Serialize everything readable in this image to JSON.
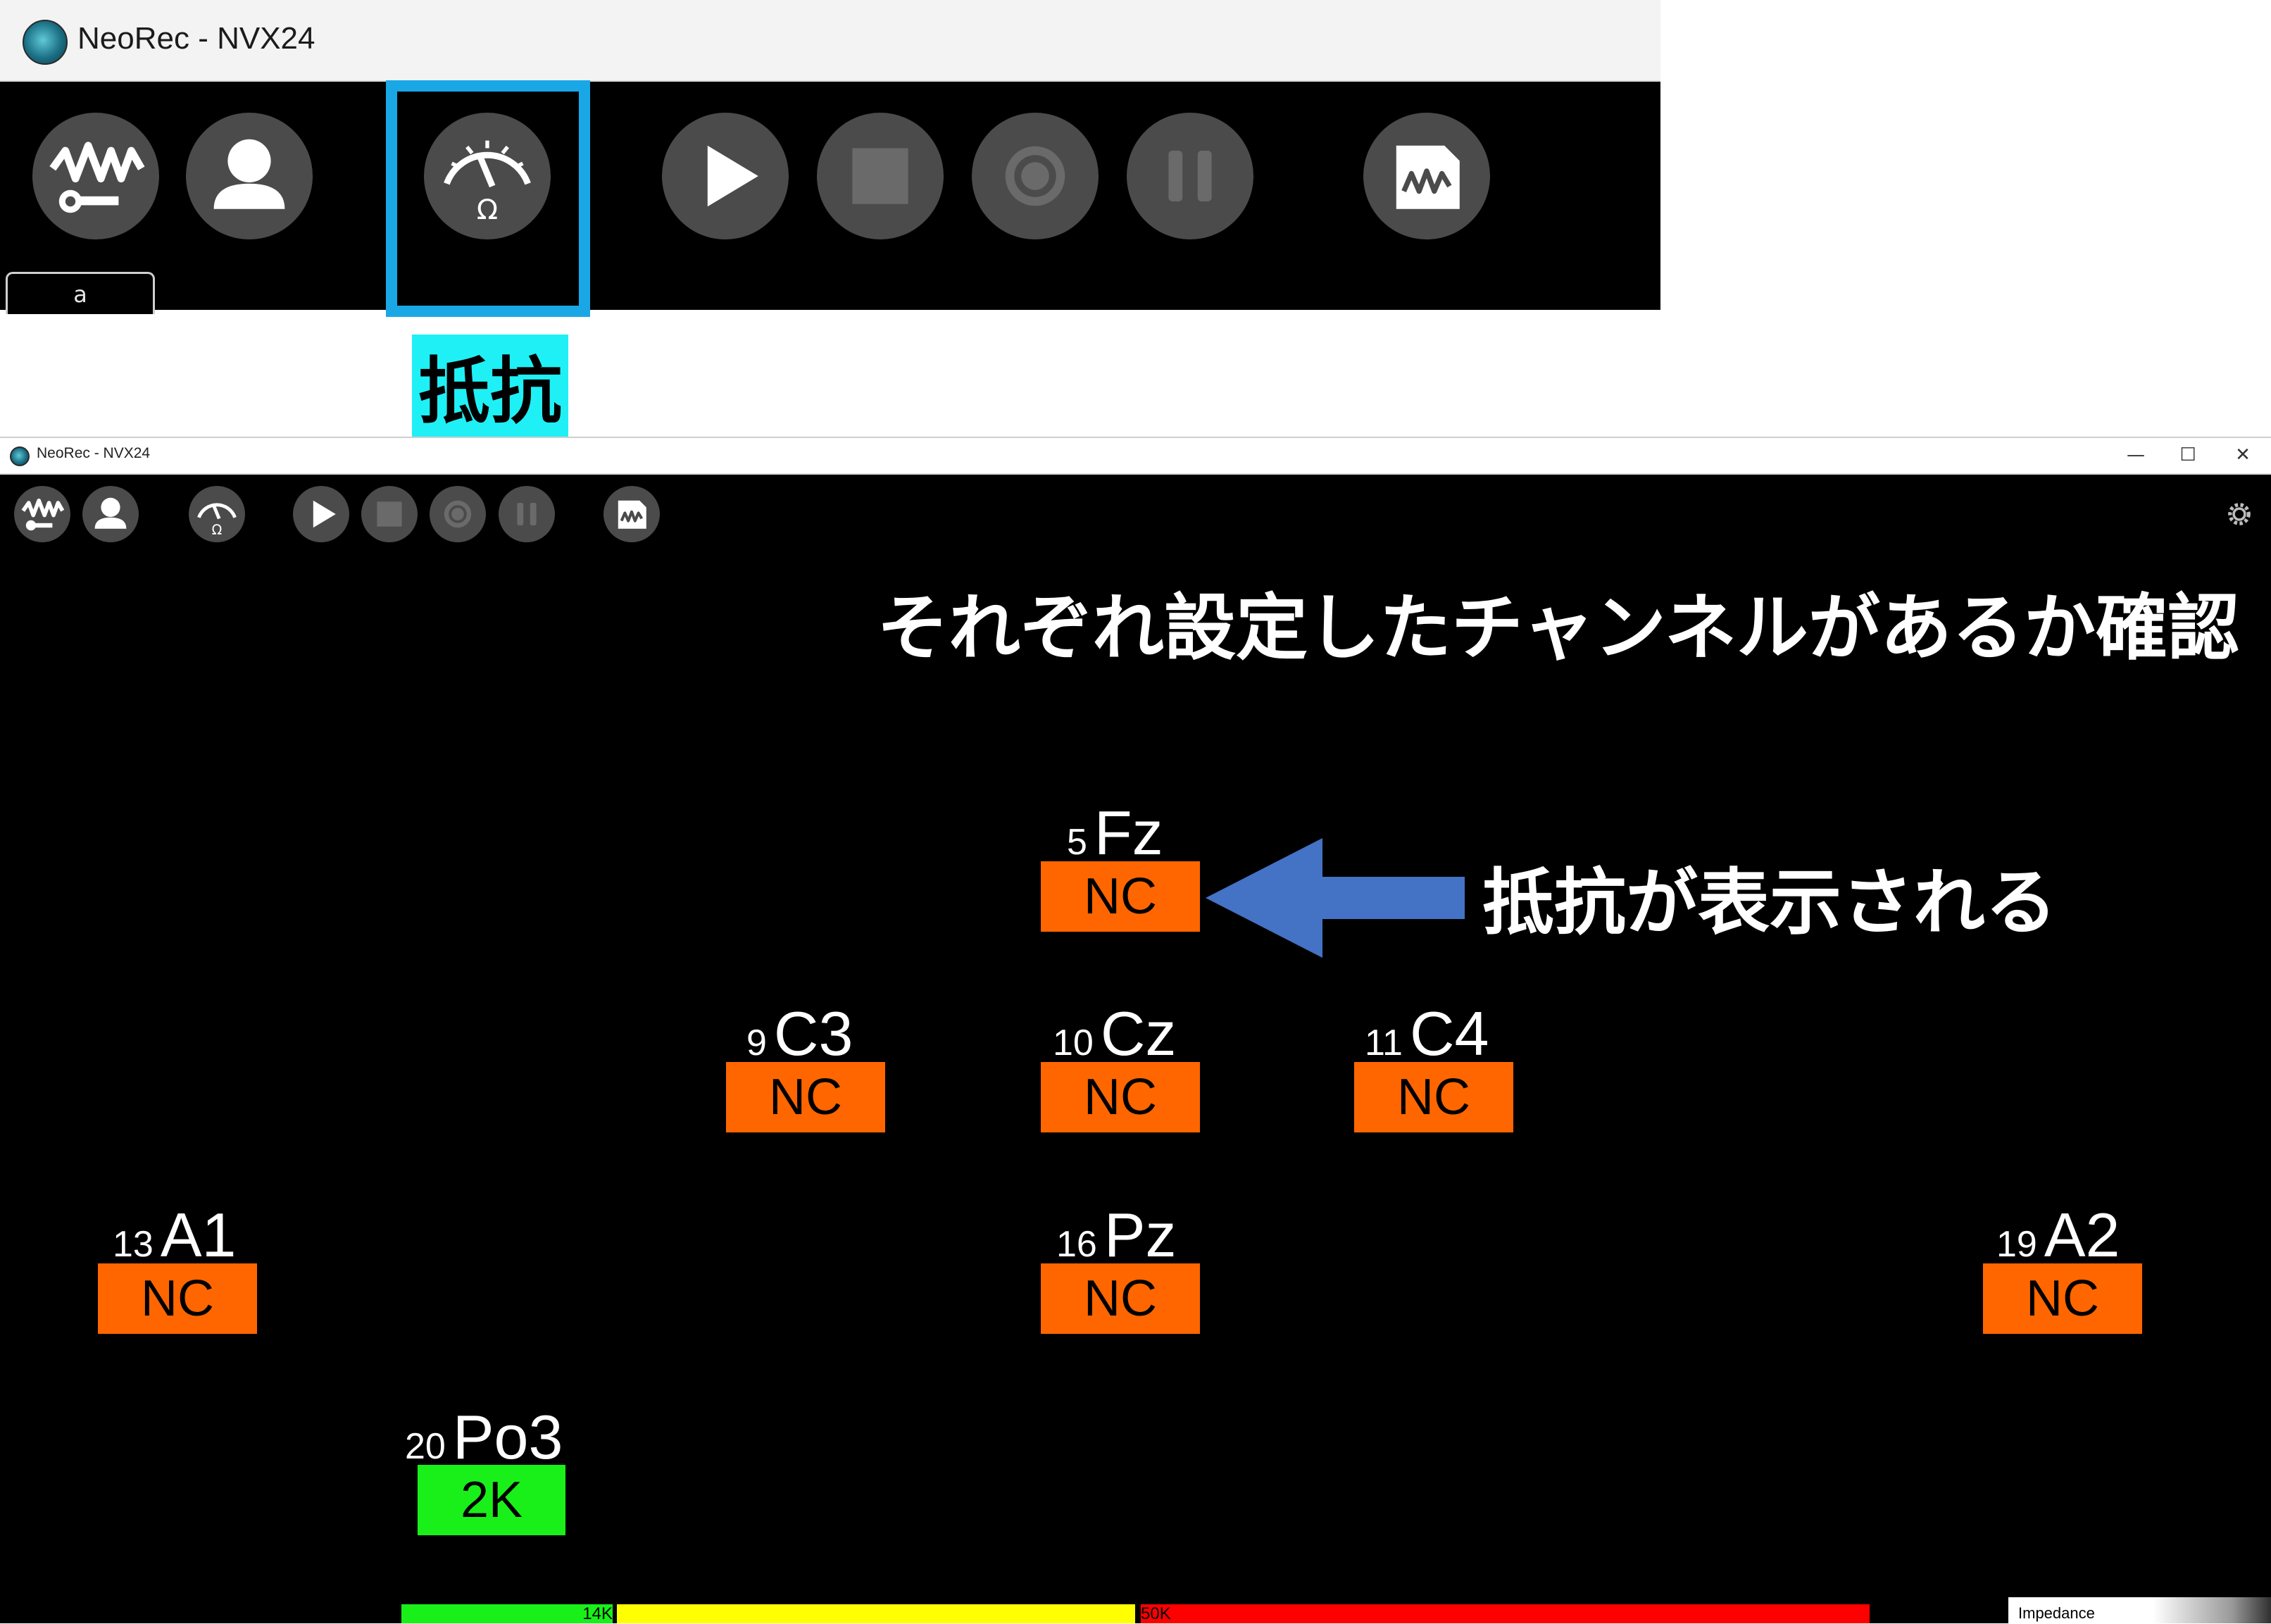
{
  "top_window": {
    "title": "NeoRec - NVX24",
    "tab_label": "a",
    "highlight_label": "抵抗"
  },
  "main_window": {
    "title": "NeoRec - NVX24",
    "controls": {
      "minimize": "—",
      "maximize": "☐",
      "close": "✕"
    }
  },
  "toolbar": {
    "buttons": [
      "amplifier-settings",
      "user",
      "impedance",
      "play",
      "stop",
      "record",
      "pause",
      "signal-view"
    ],
    "impedance_symbol": "Ω"
  },
  "annotations": {
    "title": "それぞれ設定したチャンネルがあるか確認",
    "arrow_text": "抵抗が表示される",
    "arrow_color": "#4472c4"
  },
  "electrodes": [
    {
      "num": "5",
      "name": "Fz",
      "value": "NC",
      "status": "nc"
    },
    {
      "num": "9",
      "name": "C3",
      "value": "NC",
      "status": "nc"
    },
    {
      "num": "10",
      "name": "Cz",
      "value": "NC",
      "status": "nc"
    },
    {
      "num": "11",
      "name": "C4",
      "value": "NC",
      "status": "nc"
    },
    {
      "num": "13",
      "name": "A1",
      "value": "NC",
      "status": "nc"
    },
    {
      "num": "16",
      "name": "Pz",
      "value": "NC",
      "status": "nc"
    },
    {
      "num": "19",
      "name": "A2",
      "value": "NC",
      "status": "nc"
    },
    {
      "num": "20",
      "name": "Po3",
      "value": "2K",
      "status": "ok"
    }
  ],
  "scale": {
    "labels": [
      "14K",
      "50K"
    ],
    "colors": [
      "#19f019",
      "#ffff00",
      "#ff0000"
    ]
  },
  "legend": {
    "label": "Impedance"
  },
  "colors": {
    "nc": "#ff6600",
    "ok": "#19f019",
    "highlight": "#1aa7e6",
    "label_bg": "#1ff0f5"
  }
}
